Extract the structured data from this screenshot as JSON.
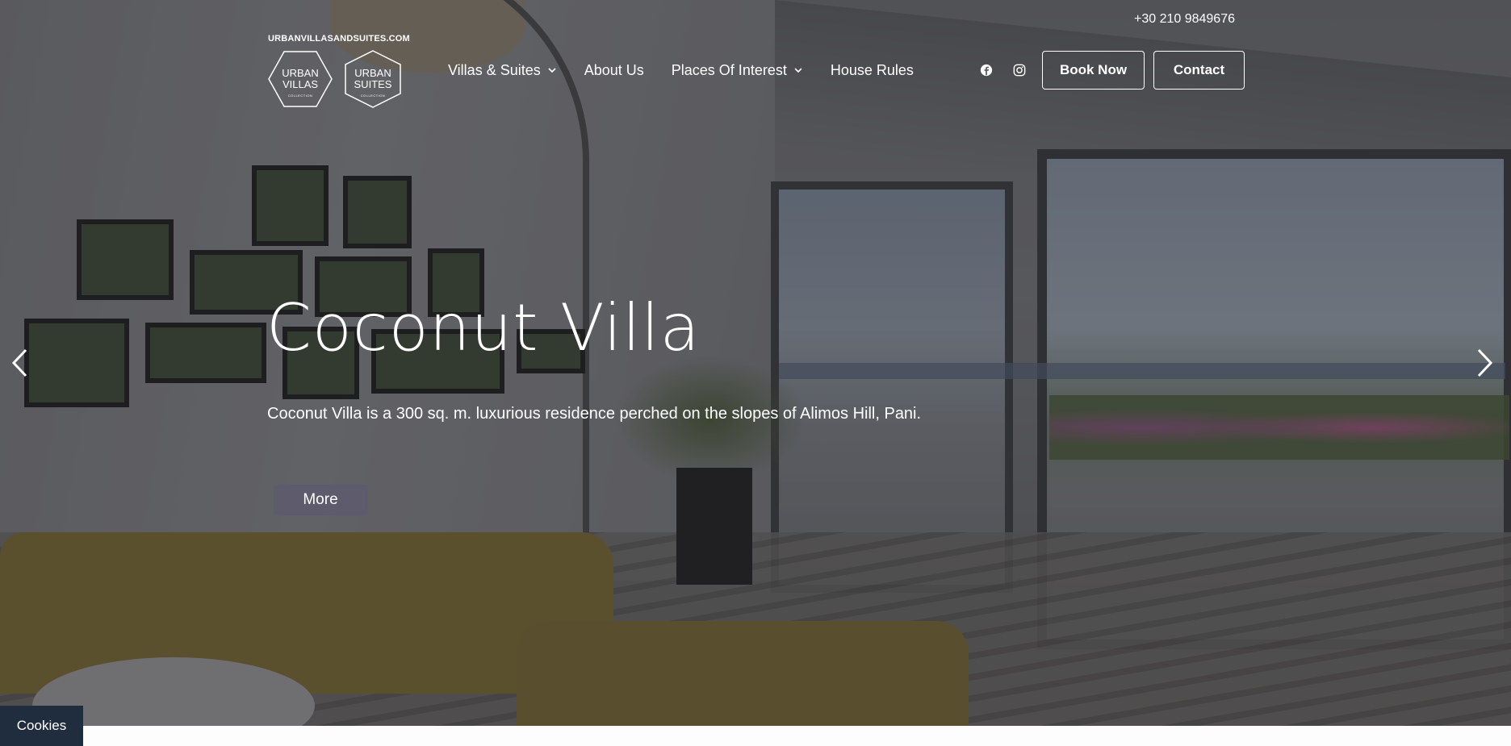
{
  "header": {
    "phone": "+30 210 9849676",
    "logo": {
      "domain_text": "URBANVILLASANDSUITES.COM",
      "villas_line1": "URBAN",
      "villas_line2": "VILLAS",
      "suites_line1": "URBAN",
      "suites_line2": "SUITES",
      "collection": "COLLECTION"
    },
    "nav": [
      {
        "label": "Villas & Suites",
        "has_dropdown": true
      },
      {
        "label": "About Us",
        "has_dropdown": false
      },
      {
        "label": "Places Of Interest",
        "has_dropdown": true
      },
      {
        "label": "House Rules",
        "has_dropdown": false
      }
    ],
    "social": [
      "facebook-icon",
      "instagram-icon"
    ],
    "book_now": "Book Now",
    "contact": "Contact"
  },
  "hero": {
    "title": "Coconut Villa",
    "subtitle": "Coconut Villa is a 300 sq. m. luxurious residence perched on the slopes of Alimos Hill, Pani.",
    "more_label": "More",
    "prev_icon": "chevron-left-icon",
    "next_icon": "chevron-right-icon"
  },
  "cookies": {
    "label": "Cookies"
  },
  "colors": {
    "more_button_bg": "#5e5b6c",
    "cookies_bg": "#1f2d3f",
    "text": "#ffffff"
  }
}
